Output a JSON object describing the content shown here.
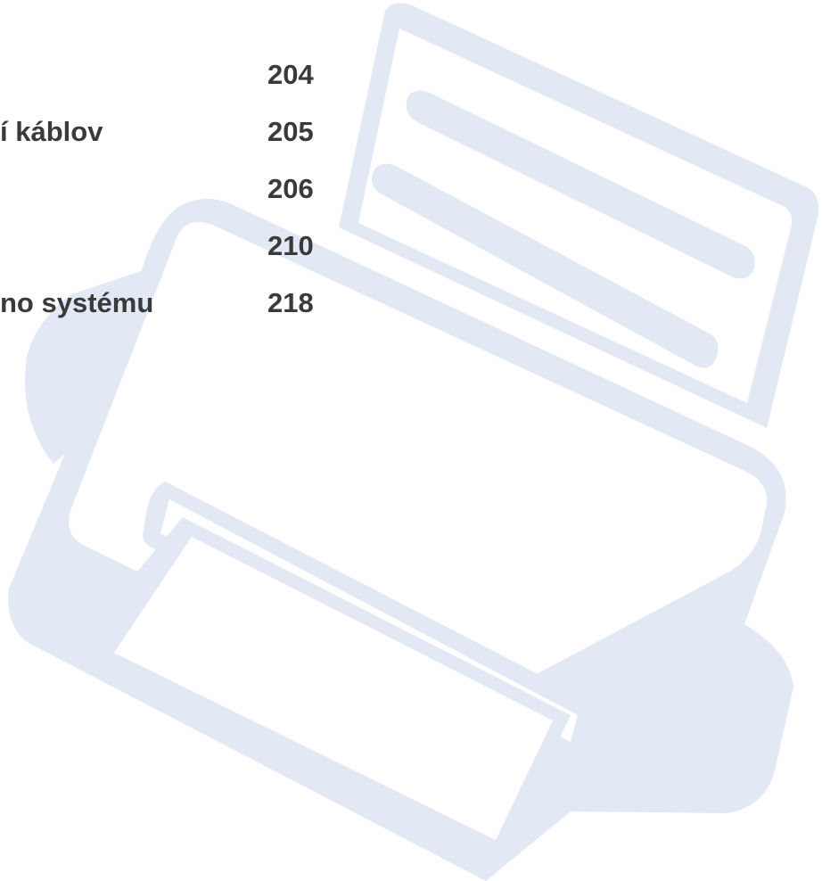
{
  "toc": {
    "entries": [
      {
        "title": "",
        "page": "204"
      },
      {
        "title": "í káblov",
        "page": "205"
      },
      {
        "title": "",
        "page": "206"
      },
      {
        "title": "",
        "page": "210"
      },
      {
        "title": "no systému",
        "page": "218"
      }
    ]
  },
  "graphic": {
    "icon": "printer-icon",
    "fill_color": "#e3e8f5",
    "background_color": "#ffffff"
  }
}
